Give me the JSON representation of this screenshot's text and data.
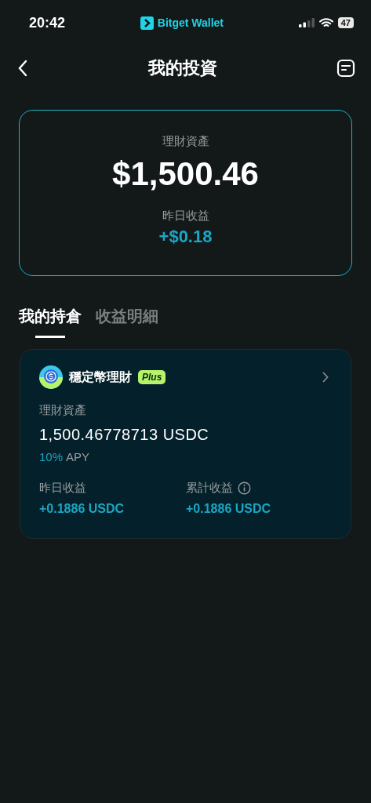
{
  "status_bar": {
    "time": "20:42",
    "app": "Bitget Wallet",
    "battery": "47"
  },
  "header": {
    "title": "我的投資"
  },
  "summary": {
    "label": "理財資產",
    "amount": "$1,500.46",
    "yesterday_label": "昨日收益",
    "yesterday_value": "+$0.18"
  },
  "tabs": [
    {
      "label": "我的持倉",
      "selected": true
    },
    {
      "label": "收益明細",
      "selected": false
    }
  ],
  "holding": {
    "name": "穩定幣理財",
    "badge": "Plus",
    "asset_label": "理財資產",
    "asset_value": "1,500.46778713 USDC",
    "apy_value": "10%",
    "apy_label": "APY",
    "stats": [
      {
        "label": "昨日收益",
        "value": "+0.1886 USDC",
        "info": false
      },
      {
        "label": "累計收益",
        "value": "+0.1886 USDC",
        "info": true
      }
    ]
  }
}
